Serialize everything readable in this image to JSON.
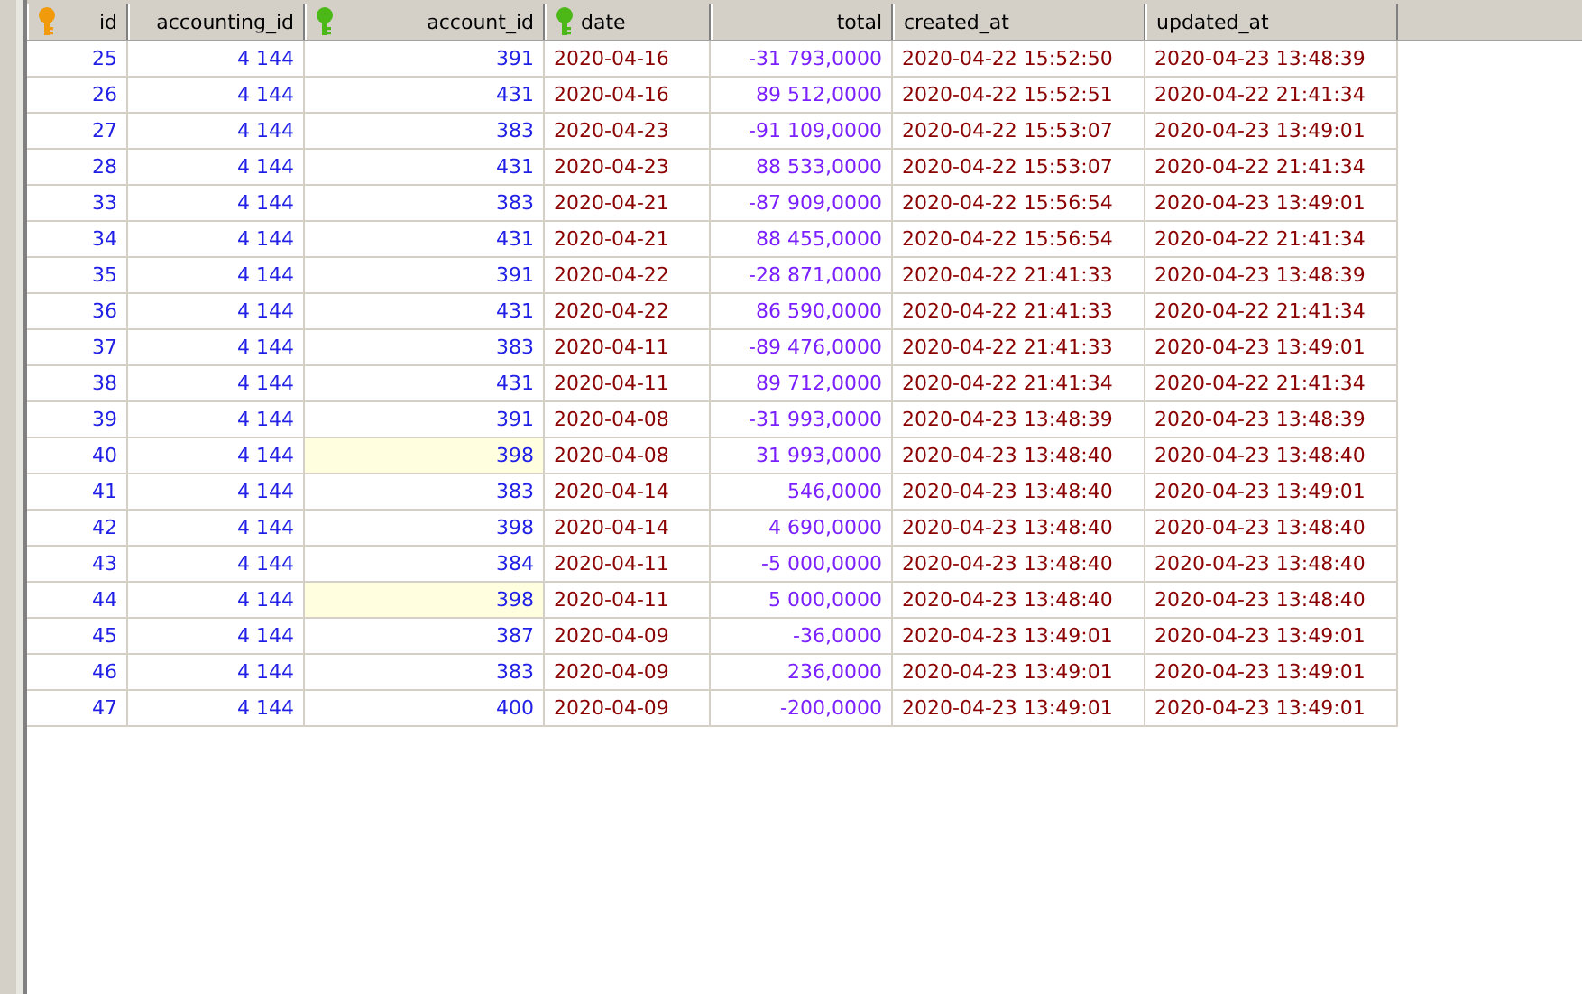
{
  "table": {
    "columns": [
      {
        "label": "id",
        "kind": "pk_number"
      },
      {
        "label": "accounting_id",
        "kind": "number"
      },
      {
        "label": "account_id",
        "kind": "fk_number"
      },
      {
        "label": "date",
        "kind": "fk_date"
      },
      {
        "label": "total",
        "kind": "decimal"
      },
      {
        "label": "created_at",
        "kind": "datetime"
      },
      {
        "label": "updated_at",
        "kind": "datetime"
      }
    ],
    "rows": [
      {
        "cells": [
          "25",
          "4 144",
          "391",
          "2020-04-16",
          "-31 793,0000",
          "2020-04-22 15:52:50",
          "2020-04-23 13:48:39"
        ],
        "account_marked": false
      },
      {
        "cells": [
          "26",
          "4 144",
          "431",
          "2020-04-16",
          "89 512,0000",
          "2020-04-22 15:52:51",
          "2020-04-22 21:41:34"
        ],
        "account_marked": false
      },
      {
        "cells": [
          "27",
          "4 144",
          "383",
          "2020-04-23",
          "-91 109,0000",
          "2020-04-22 15:53:07",
          "2020-04-23 13:49:01"
        ],
        "account_marked": false
      },
      {
        "cells": [
          "28",
          "4 144",
          "431",
          "2020-04-23",
          "88 533,0000",
          "2020-04-22 15:53:07",
          "2020-04-22 21:41:34"
        ],
        "account_marked": false
      },
      {
        "cells": [
          "33",
          "4 144",
          "383",
          "2020-04-21",
          "-87 909,0000",
          "2020-04-22 15:56:54",
          "2020-04-23 13:49:01"
        ],
        "account_marked": false
      },
      {
        "cells": [
          "34",
          "4 144",
          "431",
          "2020-04-21",
          "88 455,0000",
          "2020-04-22 15:56:54",
          "2020-04-22 21:41:34"
        ],
        "account_marked": false
      },
      {
        "cells": [
          "35",
          "4 144",
          "391",
          "2020-04-22",
          "-28 871,0000",
          "2020-04-22 21:41:33",
          "2020-04-23 13:48:39"
        ],
        "account_marked": false
      },
      {
        "cells": [
          "36",
          "4 144",
          "431",
          "2020-04-22",
          "86 590,0000",
          "2020-04-22 21:41:33",
          "2020-04-22 21:41:34"
        ],
        "account_marked": false
      },
      {
        "cells": [
          "37",
          "4 144",
          "383",
          "2020-04-11",
          "-89 476,0000",
          "2020-04-22 21:41:33",
          "2020-04-23 13:49:01"
        ],
        "account_marked": false
      },
      {
        "cells": [
          "38",
          "4 144",
          "431",
          "2020-04-11",
          "89 712,0000",
          "2020-04-22 21:41:34",
          "2020-04-22 21:41:34"
        ],
        "account_marked": false
      },
      {
        "cells": [
          "39",
          "4 144",
          "391",
          "2020-04-08",
          "-31 993,0000",
          "2020-04-23 13:48:39",
          "2020-04-23 13:48:39"
        ],
        "account_marked": false
      },
      {
        "cells": [
          "40",
          "4 144",
          "398",
          "2020-04-08",
          "31 993,0000",
          "2020-04-23 13:48:40",
          "2020-04-23 13:48:40"
        ],
        "account_marked": true
      },
      {
        "cells": [
          "41",
          "4 144",
          "383",
          "2020-04-14",
          "546,0000",
          "2020-04-23 13:48:40",
          "2020-04-23 13:49:01"
        ],
        "account_marked": false
      },
      {
        "cells": [
          "42",
          "4 144",
          "398",
          "2020-04-14",
          "4 690,0000",
          "2020-04-23 13:48:40",
          "2020-04-23 13:48:40"
        ],
        "account_marked": false
      },
      {
        "cells": [
          "43",
          "4 144",
          "384",
          "2020-04-11",
          "-5 000,0000",
          "2020-04-23 13:48:40",
          "2020-04-23 13:48:40"
        ],
        "account_marked": false
      },
      {
        "cells": [
          "44",
          "4 144",
          "398",
          "2020-04-11",
          "5 000,0000",
          "2020-04-23 13:48:40",
          "2020-04-23 13:48:40"
        ],
        "account_marked": true
      },
      {
        "cells": [
          "45",
          "4 144",
          "387",
          "2020-04-09",
          "-36,0000",
          "2020-04-23 13:49:01",
          "2020-04-23 13:49:01"
        ],
        "account_marked": false
      },
      {
        "cells": [
          "46",
          "4 144",
          "383",
          "2020-04-09",
          "236,0000",
          "2020-04-23 13:49:01",
          "2020-04-23 13:49:01"
        ],
        "account_marked": false
      },
      {
        "cells": [
          "47",
          "4 144",
          "400",
          "2020-04-09",
          "-200,0000",
          "2020-04-23 13:49:01",
          "2020-04-23 13:49:01"
        ],
        "account_marked": false
      }
    ]
  }
}
